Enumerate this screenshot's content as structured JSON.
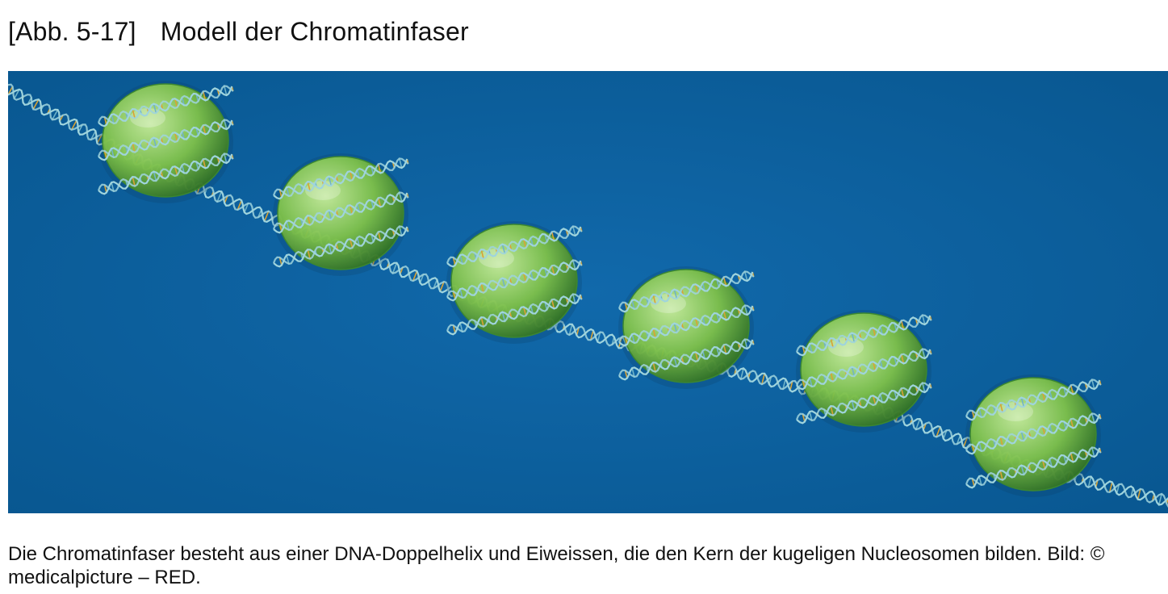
{
  "figure": {
    "number": "[Abb. 5-17]",
    "title": "Modell der Chromatinfaser",
    "caption": "Die Chromatinfaser besteht aus einer DNA-Doppelhelix und Eiweissen, die den Kern der kugeligen Nucleosomen bilden. Bild: © medicalpicture – RED.",
    "image": {
      "nucleosome_count": 6,
      "colors": {
        "background": "#0b5f9f",
        "histone_core": "#7fc24a",
        "histone_highlight": "#c9ef9a",
        "histone_shadow": "#2f6f22",
        "dna_backbone": "#9fd4dd",
        "dna_base_warm": "#d9a235",
        "dna_base_cool": "#6fb3c8"
      }
    }
  }
}
